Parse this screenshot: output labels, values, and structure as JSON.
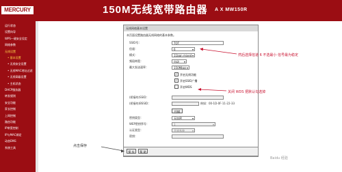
{
  "header": {
    "logo": "MERCURY",
    "title": "150M无线宽带路由器",
    "model": "A X  MW150R"
  },
  "sidebar": {
    "items": [
      {
        "label": "运行状态",
        "sub": false,
        "active": false
      },
      {
        "label": "设置向导",
        "sub": false,
        "active": false
      },
      {
        "label": "WPS一键安全设定",
        "sub": false,
        "active": false
      },
      {
        "label": "网络参数",
        "sub": false,
        "active": false
      },
      {
        "label": "无线设置",
        "sub": false,
        "active": true
      },
      {
        "label": "• 基本设置",
        "sub": true,
        "active": true
      },
      {
        "label": "• 无线安全设置",
        "sub": true,
        "active": false
      },
      {
        "label": "• 无线MAC地址过滤",
        "sub": true,
        "active": false
      },
      {
        "label": "• 无线高级设置",
        "sub": true,
        "active": false
      },
      {
        "label": "• 主机状态",
        "sub": true,
        "active": false
      },
      {
        "label": "DHCP服务器",
        "sub": false,
        "active": false
      },
      {
        "label": "转发规则",
        "sub": false,
        "active": false
      },
      {
        "label": "安全功能",
        "sub": false,
        "active": false
      },
      {
        "label": "家长控制",
        "sub": false,
        "active": false
      },
      {
        "label": "上网控制",
        "sub": false,
        "active": false
      },
      {
        "label": "路由功能",
        "sub": false,
        "active": false
      },
      {
        "label": "IP带宽控制",
        "sub": false,
        "active": false
      },
      {
        "label": "IP与MAC绑定",
        "sub": false,
        "active": false
      },
      {
        "label": "动态DNS",
        "sub": false,
        "active": false
      },
      {
        "label": "系统工具",
        "sub": false,
        "active": false
      }
    ]
  },
  "panel": {
    "title": "无线网络基本设置",
    "desc": "本页面设置路由器无线网络的基本参数。",
    "ssid_label": "SSID号：",
    "ssid_value": "TOT",
    "channel_label": "信道：",
    "channel_value": "6",
    "mode_label": "模式：",
    "mode_value": "11bgn mixed",
    "bandwidth_label": "频段带宽：",
    "bandwidth_value": "自动",
    "rate_label": "最大发送速率：",
    "rate_value": "150Mbps",
    "chk_radio": "开启无线功能",
    "chk_ssid": "开启SSID广播",
    "chk_wds": "开启WDS",
    "wds_ssid_label": "(桥接的)SSID：",
    "wds_bssid_label": "(桥接的)BSSID：",
    "wds_bssid_example": "例如：00-1D-0F-11-22-33",
    "scan_button": "扫描",
    "key_type_label": "密钥类型：",
    "key_type_value": "无加密",
    "wep_index_label": "WEP密钥序号：",
    "wep_index_value": "1",
    "auth_label": "认证类型：",
    "auth_value": "开放系统",
    "key_label": "密钥：",
    "save_button": "保 存",
    "help_button": "帮 助"
  },
  "annotations": {
    "channel_note": "然后选择信道 6 不选最小 信号最为稳定",
    "wds_note": "关闭 WDS 把默认勾选掉",
    "save_note": "点击保存"
  },
  "watermark": "Baidu 经验"
}
